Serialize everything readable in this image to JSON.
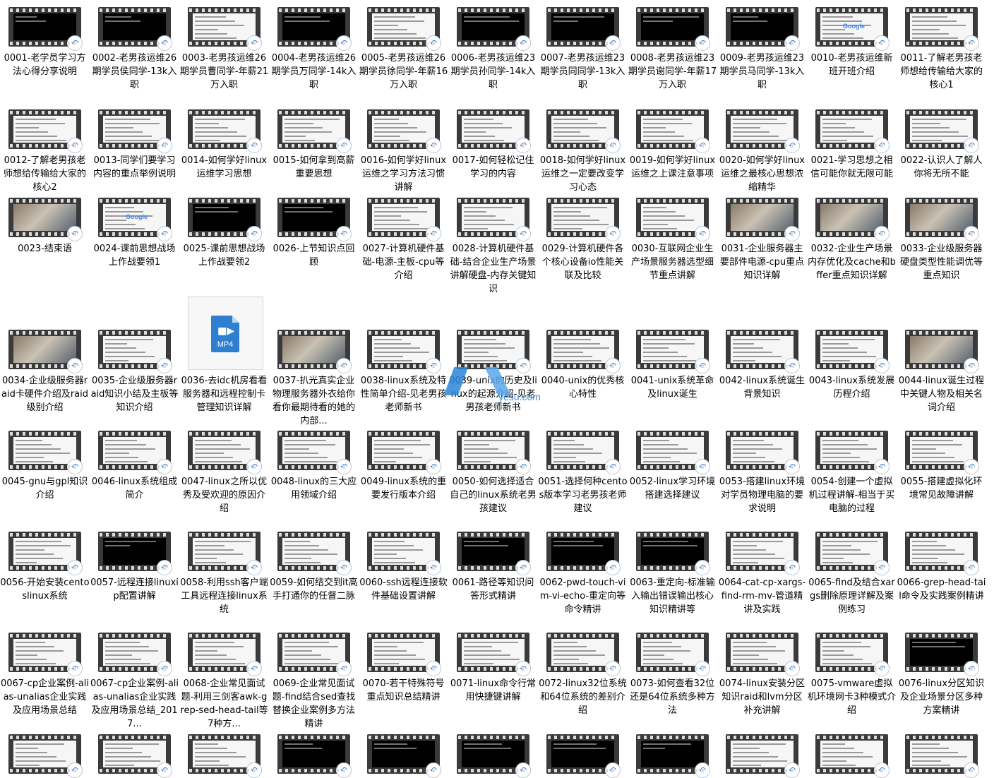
{
  "items": [
    {
      "label": "0001-老学员学习方法心得分享说明",
      "thumb": "dark"
    },
    {
      "label": "0002-老男孩运维26期学员侯同学-13k入职",
      "thumb": "dark"
    },
    {
      "label": "0003-老男孩运维26期学员曹同学-年薪21万入职",
      "thumb": "light"
    },
    {
      "label": "0004-老男孩运维26期学员万同学-14k入职",
      "thumb": "dark"
    },
    {
      "label": "0005-老男孩运维26期学员徐同学-年薪16万入职",
      "thumb": "light"
    },
    {
      "label": "0006-老男孩运维23期学员孙同学-14k入职",
      "thumb": "dark"
    },
    {
      "label": "0007-老男孩运维23期学员同同学-13k入职",
      "thumb": "dark"
    },
    {
      "label": "0008-老男孩运维23期学员谢同学-年薪17万入职",
      "thumb": "dark"
    },
    {
      "label": "0009-老男孩运维23期学员马同学-13k入职",
      "thumb": "dark"
    },
    {
      "label": "0010-老男孩运维新班开班介绍",
      "thumb": "google"
    },
    {
      "label": "0011-了解老男孩老师想给传输给大家的核心1",
      "thumb": "light"
    },
    {
      "label": "0012-了解老男孩老师想给传输给大家的核心2",
      "thumb": "light"
    },
    {
      "label": "0013-同学们要学习内容的重点举例说明",
      "thumb": "light"
    },
    {
      "label": "0014-如何学好linux运维学习思想",
      "thumb": "light"
    },
    {
      "label": "0015-如何拿到高薪重要思想",
      "thumb": "light"
    },
    {
      "label": "0016-如何学好linux运维之学习方法习惯讲解",
      "thumb": "light"
    },
    {
      "label": "0017-如何轻松记住学习的内容",
      "thumb": "light"
    },
    {
      "label": "0018-如何学好linux运维之一定要改变学习心态",
      "thumb": "light"
    },
    {
      "label": "0019-如何学好linux运维之上课注意事项",
      "thumb": "light"
    },
    {
      "label": "0020-如何学好linux运维之最核心思想浓缩精华",
      "thumb": "light"
    },
    {
      "label": "0021-学习思想之相信可能你就无限可能",
      "thumb": "light"
    },
    {
      "label": "0022-认识人了解人你将无所不能",
      "thumb": "light"
    },
    {
      "label": "0023-结束语",
      "thumb": "photo"
    },
    {
      "label": "0024-课前思想战场上作战要领1",
      "thumb": "google"
    },
    {
      "label": "0025-课前思想战场上作战要领2",
      "thumb": "dark"
    },
    {
      "label": "0026-上节知识点回顾",
      "thumb": "dark"
    },
    {
      "label": "0027-计算机硬件基础-电源-主板-cpu等介绍",
      "thumb": "light"
    },
    {
      "label": "0028-计算机硬件基础-结合企业生产场景讲解硬盘-内存关键知识",
      "thumb": "light"
    },
    {
      "label": "0029-计算机硬件各个核心设备io性能关联及比较",
      "thumb": "light"
    },
    {
      "label": "0030-互联网企业生产场景服务器选型细节重点讲解",
      "thumb": "light"
    },
    {
      "label": "0031-企业服务器主要部件电源-cpu重点知识详解",
      "thumb": "photo"
    },
    {
      "label": "0032-企业生产场景内存优化及cache和bffer重点知识详解",
      "thumb": "photo"
    },
    {
      "label": "0033-企业级服务器硬盘类型性能调优等重点知识",
      "thumb": "photo"
    },
    {
      "label": "0034-企业级服务器raid卡硬件介绍及raid级别介绍",
      "thumb": "photo"
    },
    {
      "label": "0035-企业级服务器raid知识小结及主板等知识介绍",
      "thumb": "light"
    },
    {
      "label": "0036-去idc机房看看服务器和远程控制卡管理知识详解",
      "thumb": "mp4",
      "mp4_text": "MP4"
    },
    {
      "label": "0037-扒光真实企业物理服务器外衣给你看你最期待看的她的内部...",
      "thumb": "photo"
    },
    {
      "label": "0038-linux系统及特性简单介绍-见老男孩老师新书",
      "thumb": "light"
    },
    {
      "label": "0039-unix的历史及linux的起源介绍-见老男孩老师新书",
      "thumb": "light"
    },
    {
      "label": "0040-unix的优秀核心特性",
      "thumb": "light"
    },
    {
      "label": "0041-unix系统革命及linux诞生",
      "thumb": "light"
    },
    {
      "label": "0042-linux系统诞生背景知识",
      "thumb": "light"
    },
    {
      "label": "0043-linux系统发展历程介绍",
      "thumb": "light"
    },
    {
      "label": "0044-linux诞生过程中关键人物及相关名词介绍",
      "thumb": "photo"
    },
    {
      "label": "0045-gnu与gpl知识介绍",
      "thumb": "light"
    },
    {
      "label": "0046-linux系统组成简介",
      "thumb": "light"
    },
    {
      "label": "0047-linux之所以优秀及受欢迎的原因介绍",
      "thumb": "light"
    },
    {
      "label": "0048-linux的三大应用领域介绍",
      "thumb": "light"
    },
    {
      "label": "0049-linux系统的重要发行版本介绍",
      "thumb": "light"
    },
    {
      "label": "0050-如何选择适合自己的linux系统老男孩建议",
      "thumb": "light"
    },
    {
      "label": "0051-选择何种centos版本学习老男孩老师建议",
      "thumb": "light"
    },
    {
      "label": "0052-linux学习环境搭建选择建议",
      "thumb": "light"
    },
    {
      "label": "0053-搭建linux环境对学员物理电脑的要求说明",
      "thumb": "light"
    },
    {
      "label": "0054-创建一个虚拟机过程讲解-相当于买电脑的过程",
      "thumb": "light"
    },
    {
      "label": "0055-搭建虚拟化环境常见故障讲解",
      "thumb": "light"
    },
    {
      "label": "0056-开始安装centoslinux系统",
      "thumb": "light"
    },
    {
      "label": "0057-远程连接linuxip配置讲解",
      "thumb": "dark"
    },
    {
      "label": "0058-利用ssh客户端工具远程连接linux系统",
      "thumb": "light"
    },
    {
      "label": "0059-如何结交到it高手打通你的任督二脉",
      "thumb": "light"
    },
    {
      "label": "0060-ssh远程连接软件基础设置讲解",
      "thumb": "light"
    },
    {
      "label": "0061-路径等知识问答形式精讲",
      "thumb": "dark"
    },
    {
      "label": "0062-pwd-touch-vim-vi-echo-重定向等命令精讲",
      "thumb": "dark"
    },
    {
      "label": "0063-重定向-标准输入输出错误输出核心知识精讲等",
      "thumb": "dark"
    },
    {
      "label": "0064-cat-cp-xargs-find-rm-mv-管道精讲及实践",
      "thumb": "light"
    },
    {
      "label": "0065-find及结合xargs删除原理详解及案例练习",
      "thumb": "light"
    },
    {
      "label": "0066-grep-head-tail命令及实践案例精讲",
      "thumb": "light"
    },
    {
      "label": "0067-cp企业案例-alias-unalias企业实践及应用场景总结",
      "thumb": "light"
    },
    {
      "label": "0067-cp企业案例-alias-unalias企业实践及应用场景总结_2017...",
      "thumb": "light"
    },
    {
      "label": "0068-企业常见面试题-利用三剑客awk-grep-sed-head-tail等7种方...",
      "thumb": "light"
    },
    {
      "label": "0069-企业常见面试题-find结合sed查找替换企业案例多方法精讲",
      "thumb": "light"
    },
    {
      "label": "0070-若干特殊符号重点知识总结精讲",
      "thumb": "light"
    },
    {
      "label": "0071-linux命令行常用快捷键讲解",
      "thumb": "light"
    },
    {
      "label": "0072-linux32位系统和64位系统的差别介绍",
      "thumb": "light"
    },
    {
      "label": "0073-如何查看32位还是64位系统多种方法",
      "thumb": "light"
    },
    {
      "label": "0074-linux安装分区知识raid和lvm分区补充讲解",
      "thumb": "light"
    },
    {
      "label": "0075-vmware虚拟机环境网卡3种模式介绍",
      "thumb": "light"
    },
    {
      "label": "0076-linux分区知识及企业场景分区多种方案精讲",
      "thumb": "dark"
    },
    {
      "label": "",
      "thumb": "light"
    },
    {
      "label": "",
      "thumb": "light"
    },
    {
      "label": "",
      "thumb": "light"
    },
    {
      "label": "",
      "thumb": "dark"
    },
    {
      "label": "",
      "thumb": "dark"
    },
    {
      "label": "",
      "thumb": "dark"
    },
    {
      "label": "",
      "thumb": "dark"
    },
    {
      "label": "",
      "thumb": "dark"
    },
    {
      "label": "",
      "thumb": "light"
    },
    {
      "label": "",
      "thumb": "light"
    },
    {
      "label": "",
      "thumb": "light"
    }
  ],
  "google_text": "Google",
  "watermark": {
    "text": "yesu.com"
  }
}
